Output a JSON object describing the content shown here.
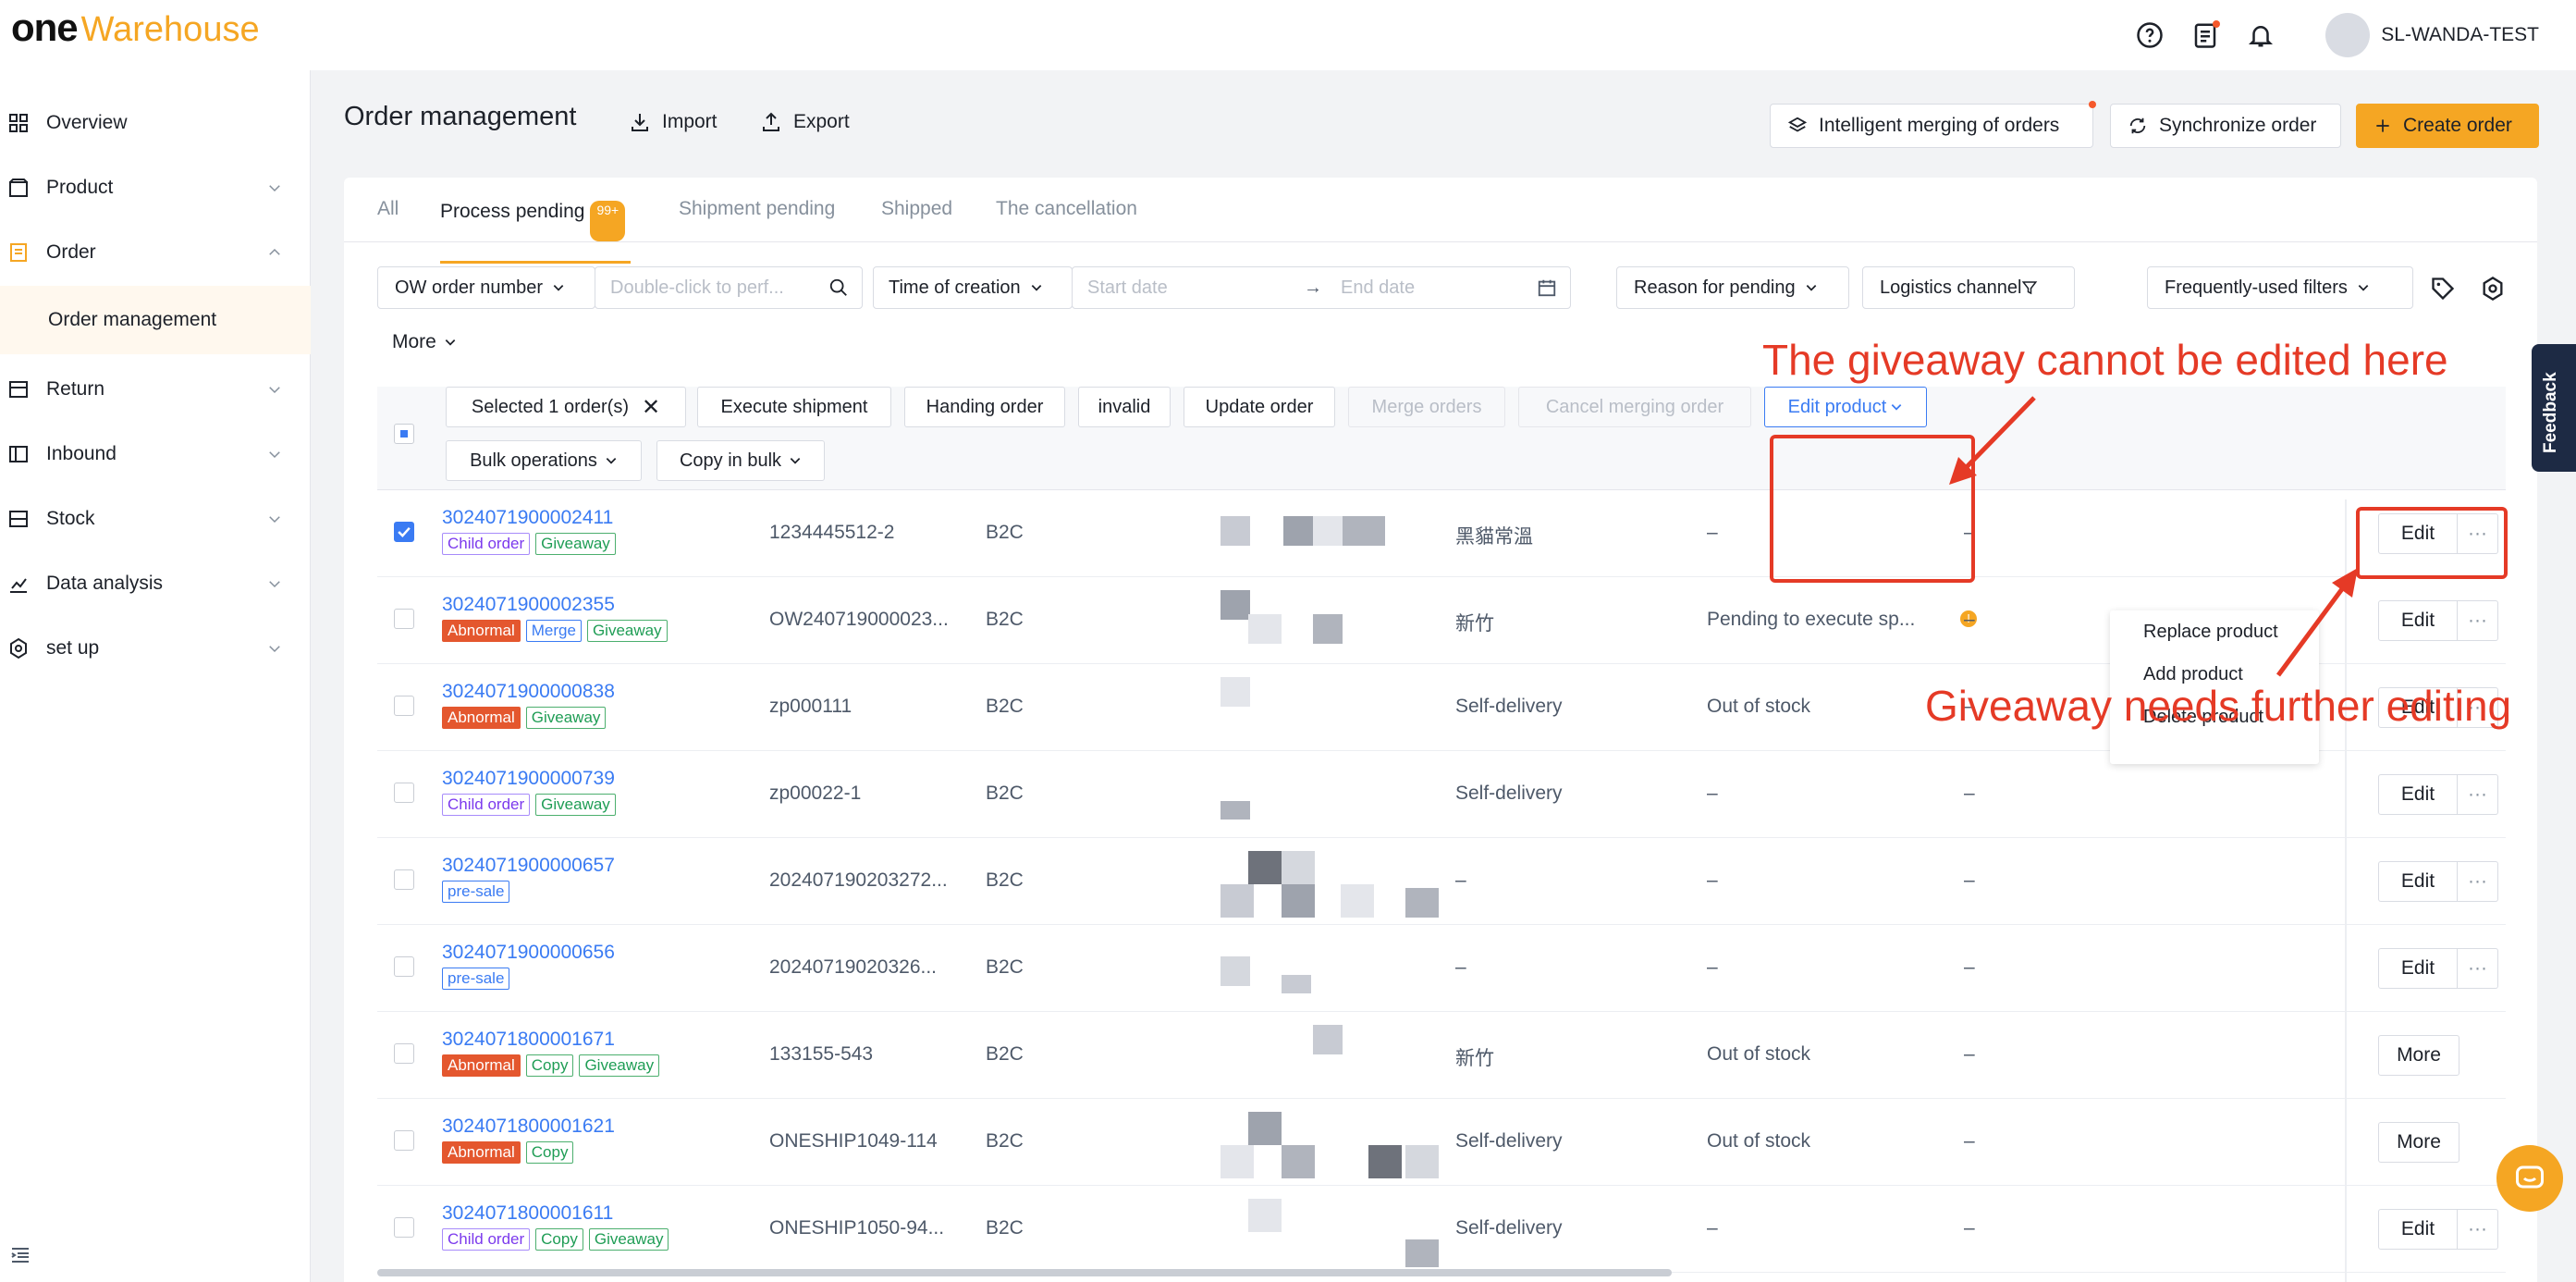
{
  "app": {
    "logo_one": "one",
    "logo_warehouse": "Warehouse",
    "user": "SL-WANDA-TEST"
  },
  "sidebar": {
    "items": [
      {
        "label": "Overview"
      },
      {
        "label": "Product"
      },
      {
        "label": "Order"
      },
      {
        "label": "Return"
      },
      {
        "label": "Inbound"
      },
      {
        "label": "Stock"
      },
      {
        "label": "Data analysis"
      },
      {
        "label": "set up"
      }
    ],
    "sub_item": "Order management"
  },
  "page": {
    "title": "Order management",
    "import": "Import",
    "export": "Export",
    "intelligent_merge": "Intelligent merging of orders",
    "synchronize": "Synchronize order",
    "create": "Create order"
  },
  "tabs": [
    {
      "label": "All"
    },
    {
      "label": "Process pending",
      "badge": "99+"
    },
    {
      "label": "Shipment pending"
    },
    {
      "label": "Shipped"
    },
    {
      "label": "The cancellation"
    }
  ],
  "filters": {
    "order_number": "OW order number",
    "search_placeholder": "Double-click to perf...",
    "time": "Time of creation",
    "start_placeholder": "Start date",
    "end_placeholder": "End date",
    "reason": "Reason for pending",
    "logistics": "Logistics channel",
    "frequent": "Frequently-used filters",
    "more": "More"
  },
  "bulk": {
    "selected": "Selected 1 order(s)",
    "execute": "Execute shipment",
    "handing": "Handing order",
    "invalid": "invalid",
    "update": "Update order",
    "merge": "Merge orders",
    "cancel_merge": "Cancel merging order",
    "edit_product": "Edit product",
    "bulk_ops": "Bulk operations",
    "copy_bulk": "Copy in bulk"
  },
  "dropdown": [
    "Replace product",
    "Add product",
    "Delete product"
  ],
  "annotations": {
    "top": "The giveaway cannot be edited here",
    "bottom": "Giveaway needs further editing"
  },
  "rows": [
    {
      "id": "3024071900002411",
      "tags": [
        "Child order",
        "Giveaway"
      ],
      "ref": "1234445512-2",
      "type": "B2C",
      "logistics": "黑貓常溫",
      "reason": "–",
      "extra": "–",
      "action": "Edit",
      "checked": true
    },
    {
      "id": "3024071900002355",
      "tags": [
        "Abnormal",
        "Merge",
        "Giveaway"
      ],
      "ref": "OW240719000023...",
      "type": "B2C",
      "logistics": "新竹",
      "reason": "Pending to execute sp...",
      "extra": "–",
      "action": "Edit",
      "checked": false
    },
    {
      "id": "3024071900000838",
      "tags": [
        "Abnormal",
        "Giveaway"
      ],
      "ref": "zp000111",
      "type": "B2C",
      "logistics": "Self-delivery",
      "reason": "Out of stock",
      "extra": "–",
      "action": "Edit",
      "checked": false
    },
    {
      "id": "3024071900000739",
      "tags": [
        "Child order",
        "Giveaway"
      ],
      "ref": "zp00022-1",
      "type": "B2C",
      "logistics": "Self-delivery",
      "reason": "–",
      "extra": "–",
      "action": "Edit",
      "checked": false
    },
    {
      "id": "3024071900000657",
      "tags": [
        "pre-sale"
      ],
      "ref": "202407190203272...",
      "type": "B2C",
      "logistics": "–",
      "reason": "–",
      "extra": "–",
      "action": "Edit",
      "checked": false
    },
    {
      "id": "3024071900000656",
      "tags": [
        "pre-sale"
      ],
      "ref": "20240719020326...",
      "type": "B2C",
      "logistics": "–",
      "reason": "–",
      "extra": "–",
      "action": "Edit",
      "checked": false
    },
    {
      "id": "3024071800001671",
      "tags": [
        "Abnormal",
        "Copy",
        "Giveaway"
      ],
      "ref": "133155-543",
      "type": "B2C",
      "logistics": "新竹",
      "reason": "Out of stock",
      "extra": "–",
      "action": "More",
      "checked": false
    },
    {
      "id": "3024071800001621",
      "tags": [
        "Abnormal",
        "Copy"
      ],
      "ref": "ONESHIP1049-114",
      "type": "B2C",
      "logistics": "Self-delivery",
      "reason": "Out of stock",
      "extra": "–",
      "action": "More",
      "checked": false
    },
    {
      "id": "3024071800001611",
      "tags": [
        "Child order",
        "Copy",
        "Giveaway"
      ],
      "ref": "ONESHIP1050-94...",
      "type": "B2C",
      "logistics": "Self-delivery",
      "reason": "–",
      "extra": "–",
      "action": "Edit",
      "checked": false
    }
  ],
  "feedback": "Feedback",
  "more_dots": "···"
}
